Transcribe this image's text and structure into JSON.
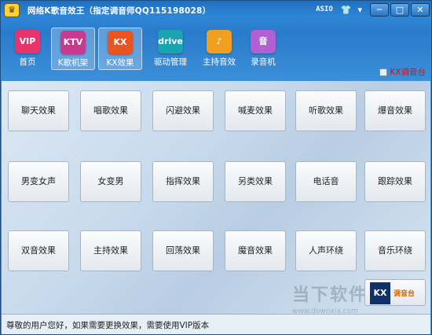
{
  "window": {
    "title": "网络K歌音效王（指定调音师QQ115198028）",
    "asio_label": "ASIO",
    "controls": {
      "minimize": "─",
      "maximize": "□",
      "close": "✕"
    }
  },
  "toolbar": {
    "items": [
      {
        "label": "首页",
        "icon_text": "VIP",
        "icon": "vip-crown-icon",
        "color": "#e8336d"
      },
      {
        "label": "K歌机架",
        "icon_text": "KTV",
        "icon": "ktv-mic-icon",
        "color": "#c83a8e"
      },
      {
        "label": "KX效果",
        "icon_text": "KX",
        "icon": "kx-icon",
        "color": "#e85520"
      },
      {
        "label": "驱动管理",
        "icon_text": "drive",
        "icon": "drive-icon",
        "color": "#1aa3b0"
      },
      {
        "label": "主持音效",
        "icon_text": "♪",
        "icon": "folder-music-icon",
        "color": "#f0a020"
      },
      {
        "label": "录音机",
        "icon_text": "音",
        "icon": "recorder-icon",
        "color": "#b060d0"
      }
    ],
    "active_index": 2
  },
  "kx_console": {
    "label": "KX调音台"
  },
  "effects": [
    [
      "聊天效果",
      "唱歌效果",
      "闪避效果",
      "喊麦效果",
      "听歌效果",
      "爆音效果"
    ],
    [
      "男变女声",
      "女变男",
      "指挥效果",
      "另类效果",
      "电话音",
      "跟踪效果"
    ],
    [
      "双音效果",
      "主持效果",
      "回荡效果",
      "魔音效果",
      "人声环绕",
      "音乐环绕"
    ]
  ],
  "kx_badge": {
    "icon_text": "KX",
    "text": "调音台"
  },
  "watermark": {
    "title": "当下软件园",
    "url": "www.downxia.com"
  },
  "status": {
    "text": "尊敬的用户您好，如果需要更换效果，需要使用VIP版本"
  }
}
